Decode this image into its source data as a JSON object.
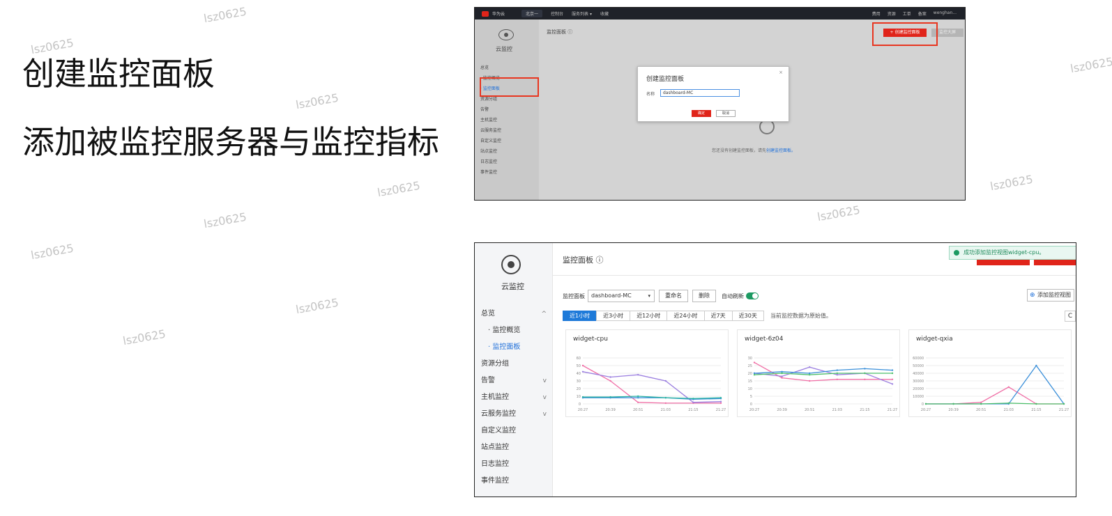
{
  "slide": {
    "title": "创建监控面板",
    "subtitle": "添加被监控服务器与监控指标",
    "watermark": "lsz0625"
  },
  "shot1": {
    "topbar": {
      "brand": "华为云",
      "region": "北京一",
      "items": [
        "控制台",
        "服务列表 ▾",
        "收藏"
      ],
      "right_items": [
        "费用",
        "资源",
        "工单",
        "备案",
        "wenghan..."
      ]
    },
    "sidebar": {
      "brand": "云监控",
      "items": [
        {
          "label": "总览",
          "chev": "^"
        },
        {
          "label": "· 监控概览",
          "chev": ""
        },
        {
          "label": "· 监控面板",
          "chev": "",
          "active": true
        },
        {
          "label": "资源分组",
          "chev": ""
        },
        {
          "label": "告警",
          "chev": "v"
        },
        {
          "label": "主机监控",
          "chev": "v"
        },
        {
          "label": "云服务监控",
          "chev": "v"
        },
        {
          "label": "自定义监控",
          "chev": ""
        },
        {
          "label": "站点监控",
          "chev": ""
        },
        {
          "label": "日志监控",
          "chev": ""
        },
        {
          "label": "事件监控",
          "chev": ""
        }
      ]
    },
    "header": {
      "title": "监控面板 ⓘ",
      "create_button": "+ 创建监控面板",
      "bigscreen_button": "监控大屏"
    },
    "dialog": {
      "title": "创建监控面板",
      "close": "×",
      "name_label": "名称",
      "name_value": "dashboard-MC",
      "ok": "确定",
      "cancel": "取消"
    },
    "empty_text": "您还没有创建监控面板，请先",
    "empty_link": "创建监控面板。"
  },
  "shot2": {
    "sidebar": {
      "brand": "云监控",
      "items": [
        {
          "label": "总览",
          "chev": "^",
          "sub": false,
          "active": false
        },
        {
          "label": "· 监控概览",
          "chev": "",
          "sub": true,
          "active": false
        },
        {
          "label": "· 监控面板",
          "chev": "",
          "sub": true,
          "active": true
        },
        {
          "label": "资源分组",
          "chev": "",
          "sub": false,
          "active": false
        },
        {
          "label": "告警",
          "chev": "v",
          "sub": false,
          "active": false
        },
        {
          "label": "主机监控",
          "chev": "v",
          "sub": false,
          "active": false
        },
        {
          "label": "云服务监控",
          "chev": "v",
          "sub": false,
          "active": false
        },
        {
          "label": "自定义监控",
          "chev": "",
          "sub": false,
          "active": false
        },
        {
          "label": "站点监控",
          "chev": "",
          "sub": false,
          "active": false
        },
        {
          "label": "日志监控",
          "chev": "",
          "sub": false,
          "active": false
        },
        {
          "label": "事件监控",
          "chev": "",
          "sub": false,
          "active": false
        }
      ]
    },
    "title": "监控面板 ⓘ",
    "toast": "成功添加监控视图widget-cpu。",
    "toolbar": {
      "panel_label": "监控面板",
      "panel_value": "dashboard-MC",
      "rename": "重命名",
      "delete": "删除",
      "auto_refresh": "自动刷新",
      "add_view": "添加监控视图"
    },
    "time_tabs": [
      "近1小时",
      "近3小时",
      "近12小时",
      "近24小时",
      "近7天",
      "近30天"
    ],
    "time_note": "当前监控数据为原始值。",
    "refresh_icon": "C",
    "colors": {
      "pink": "#f06fa6",
      "purple": "#9b7fe0",
      "blue": "#3a8fd9",
      "teal": "#2bb3a3",
      "green": "#4cbf6a",
      "accent": "#1e7ad9",
      "red": "#e0241a"
    }
  },
  "chart_data": [
    {
      "type": "line",
      "title": "widget-cpu",
      "x": [
        "20:27",
        "20:39",
        "20:51",
        "21:03",
        "21:15",
        "21:27"
      ],
      "ylim": [
        0,
        60
      ],
      "yticks": [
        0,
        10,
        20,
        30,
        40,
        50,
        60
      ],
      "series": [
        {
          "color": "#f06fa6",
          "values": [
            50,
            30,
            2,
            1,
            1,
            1
          ]
        },
        {
          "color": "#9b7fe0",
          "values": [
            42,
            35,
            38,
            30,
            2,
            3
          ]
        },
        {
          "color": "#3a8fd9",
          "values": [
            8,
            8,
            8,
            8,
            6,
            7
          ]
        },
        {
          "color": "#2bb3a3",
          "values": [
            9,
            9,
            10,
            8,
            7,
            8
          ]
        }
      ]
    },
    {
      "type": "line",
      "title": "widget-6z04",
      "x": [
        "20:27",
        "20:39",
        "20:51",
        "21:03",
        "21:15",
        "21:27"
      ],
      "ylim": [
        0,
        30
      ],
      "yticks": [
        0,
        5,
        10,
        15,
        20,
        25,
        30
      ],
      "series": [
        {
          "color": "#f06fa6",
          "values": [
            27,
            17,
            15,
            16,
            16,
            16
          ]
        },
        {
          "color": "#9b7fe0",
          "values": [
            20,
            18,
            24,
            19,
            20,
            13
          ]
        },
        {
          "color": "#3a8fd9",
          "values": [
            20,
            21,
            20,
            22,
            23,
            22
          ]
        },
        {
          "color": "#4cbf6a",
          "values": [
            19,
            20,
            19,
            20,
            20,
            20
          ]
        }
      ]
    },
    {
      "type": "line",
      "title": "widget-qxia",
      "x": [
        "20:27",
        "20:39",
        "20:51",
        "21:03",
        "21:15",
        "21:27"
      ],
      "ylim": [
        0,
        60000
      ],
      "yticks": [
        0,
        10000,
        20000,
        30000,
        40000,
        50000,
        60000
      ],
      "series": [
        {
          "color": "#f06fa6",
          "values": [
            0,
            0,
            2000,
            22000,
            0,
            0
          ]
        },
        {
          "color": "#3a8fd9",
          "values": [
            0,
            0,
            0,
            0,
            50000,
            0
          ]
        },
        {
          "color": "#4cbf6a",
          "values": [
            0,
            0,
            0,
            1000,
            0,
            0
          ]
        }
      ]
    }
  ]
}
